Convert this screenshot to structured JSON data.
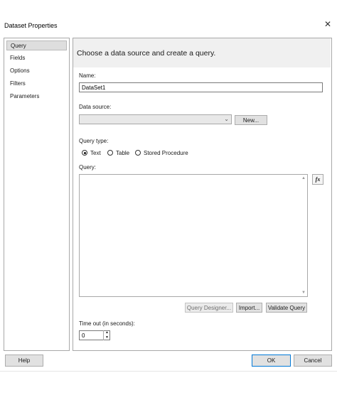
{
  "window": {
    "title": "Dataset Properties"
  },
  "nav": {
    "items": [
      "Query",
      "Fields",
      "Options",
      "Filters",
      "Parameters"
    ]
  },
  "panel": {
    "header": "Choose a data source and create a query."
  },
  "form": {
    "name_label": "Name:",
    "name_value": "DataSet1",
    "datasource_label": "Data source:",
    "datasource_value": "",
    "new_button": "New...",
    "querytype_label": "Query type:",
    "querytype_options": [
      "Text",
      "Table",
      "Stored Procedure"
    ],
    "querytype_selected": "Text",
    "query_label": "Query:",
    "query_text": "",
    "fx_label": "fx",
    "query_designer_button": "Query Designer...",
    "import_button": "Import...",
    "validate_button": "Validate Query",
    "timeout_label": "Time out (in seconds):",
    "timeout_value": "0"
  },
  "footer": {
    "help": "Help",
    "ok": "OK",
    "cancel": "Cancel"
  }
}
